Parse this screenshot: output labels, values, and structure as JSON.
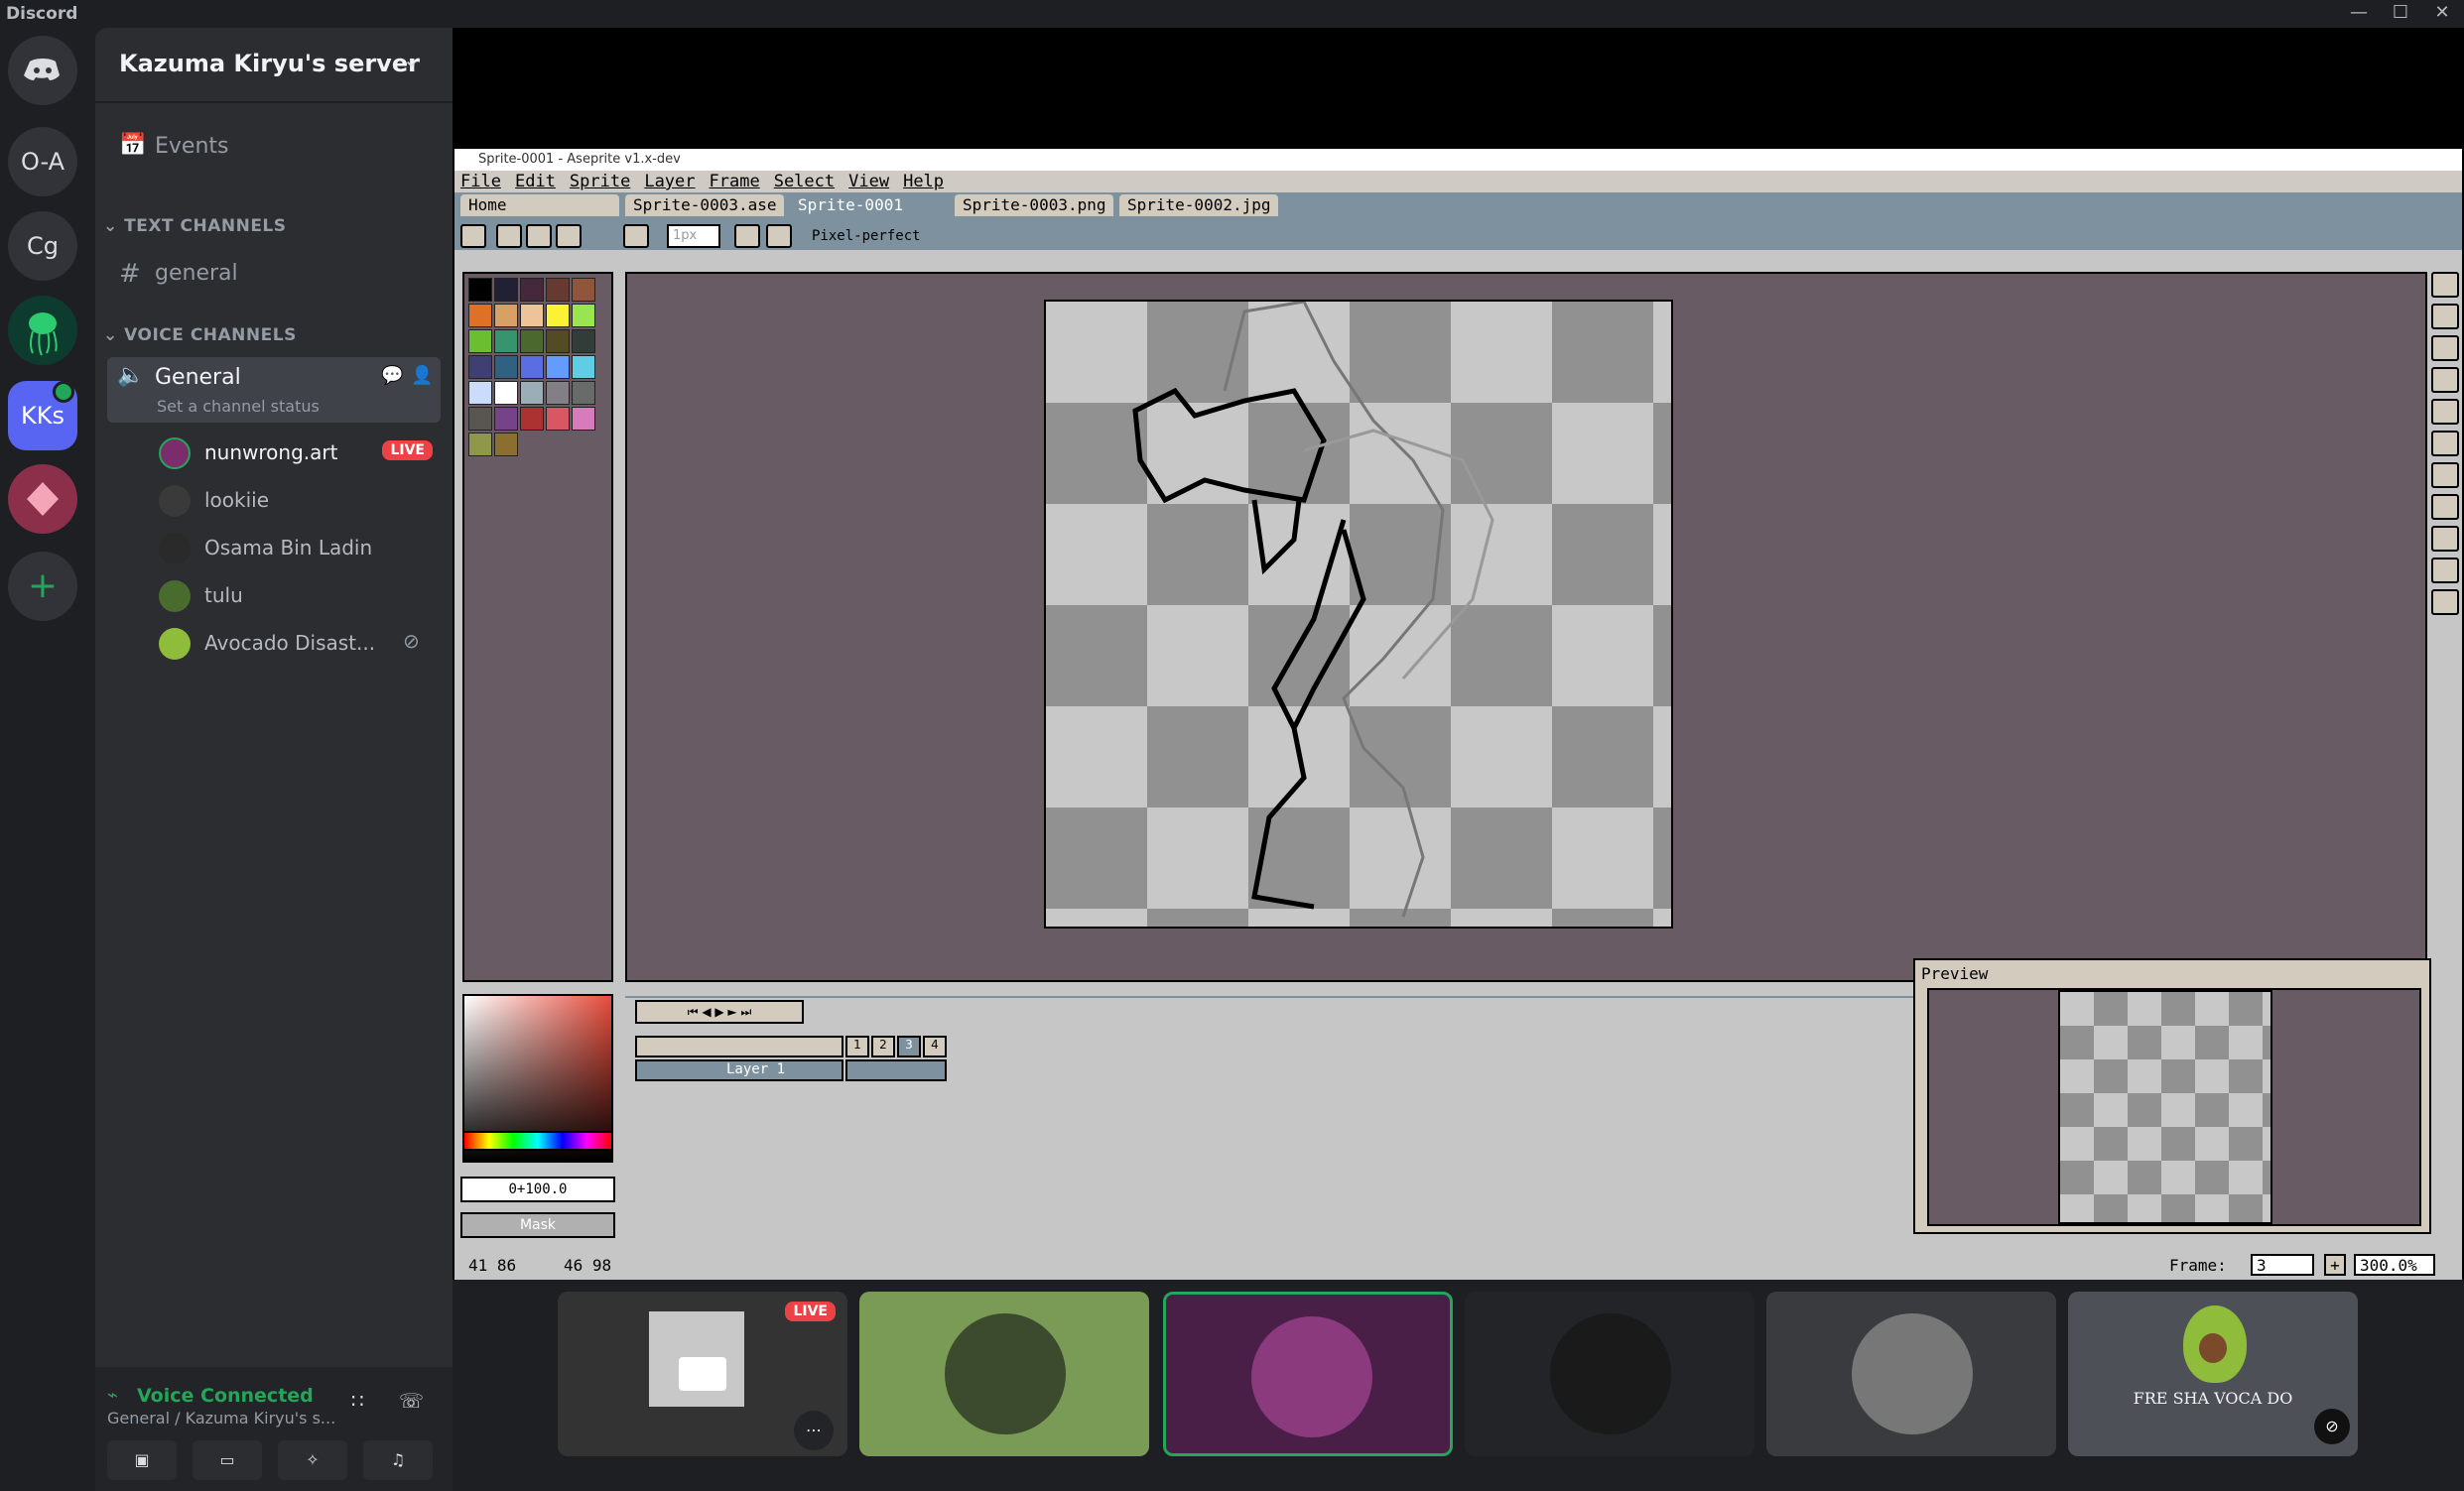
{
  "app": {
    "title": "Discord"
  },
  "rail": {
    "items": [
      "O-A",
      "Cg",
      "KKs"
    ]
  },
  "server": {
    "name": "Kazuma Kiryu's server"
  },
  "sidebar": {
    "events": "Events",
    "text_channels": "TEXT CHANNELS",
    "general_text": "general",
    "voice_channels": "VOICE CHANNELS",
    "general_voice": "General",
    "channel_status": "Set a channel status",
    "members": [
      {
        "name": "nunwrong.art",
        "live": "LIVE"
      },
      {
        "name": "lookiie"
      },
      {
        "name": "Osama Bin Ladin"
      },
      {
        "name": "tulu"
      },
      {
        "name": "Avocado Disast..."
      }
    ]
  },
  "voice": {
    "status": "Voice Connected",
    "location": "General / Kazuma Kiryu's s..."
  },
  "aseprite": {
    "title": "Sprite-0001 - Aseprite v1.x-dev",
    "menu": [
      "File",
      "Edit",
      "Sprite",
      "Layer",
      "Frame",
      "Select",
      "View",
      "Help"
    ],
    "tabs": [
      "Home",
      "Sprite-0003.ase",
      "Sprite-0001",
      "Sprite-0003.png",
      "Sprite-0002.jpg"
    ],
    "brush_size": "1px",
    "pixel_perfect": "Pixel-perfect",
    "color_value": "0+100.0",
    "mask_label": "Mask",
    "layer_name": "Layer 1",
    "frame_numbers": [
      "1",
      "2",
      "3",
      "4"
    ],
    "preview_title": "Preview",
    "status_coords": "41 86",
    "status_size": "46 98",
    "frame_label": "Frame:",
    "frame_value": "3",
    "zoom": "300.0%"
  },
  "tiles": {
    "live_badge": "LIVE",
    "avocado_text": "FRE SHA VOCA DO"
  },
  "colors": {
    "accent": "#5865f2",
    "live": "#ed4245",
    "voice_green": "#23a55a",
    "canvas_bg": "#685b63"
  }
}
